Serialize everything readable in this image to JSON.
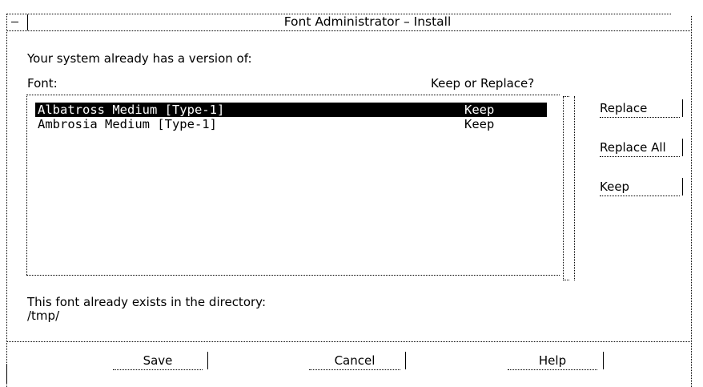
{
  "window": {
    "title": "Font Administrator – Install"
  },
  "header": {
    "message": "Your system already has a version of:",
    "font_column": "Font:",
    "action_column": "Keep or Replace?"
  },
  "fonts": [
    {
      "name": "Albatross Medium [Type-1]",
      "action": "Keep",
      "selected": true
    },
    {
      "name": "Ambrosia Medium [Type-1]",
      "action": "Keep",
      "selected": false
    }
  ],
  "side_buttons": {
    "replace": "Replace",
    "replace_all": "Replace All",
    "keep": "Keep"
  },
  "footer": {
    "exists_message": "This font already exists in the directory:",
    "directory": "/tmp/"
  },
  "buttons": {
    "save": "Save",
    "cancel": "Cancel",
    "help": "Help"
  }
}
